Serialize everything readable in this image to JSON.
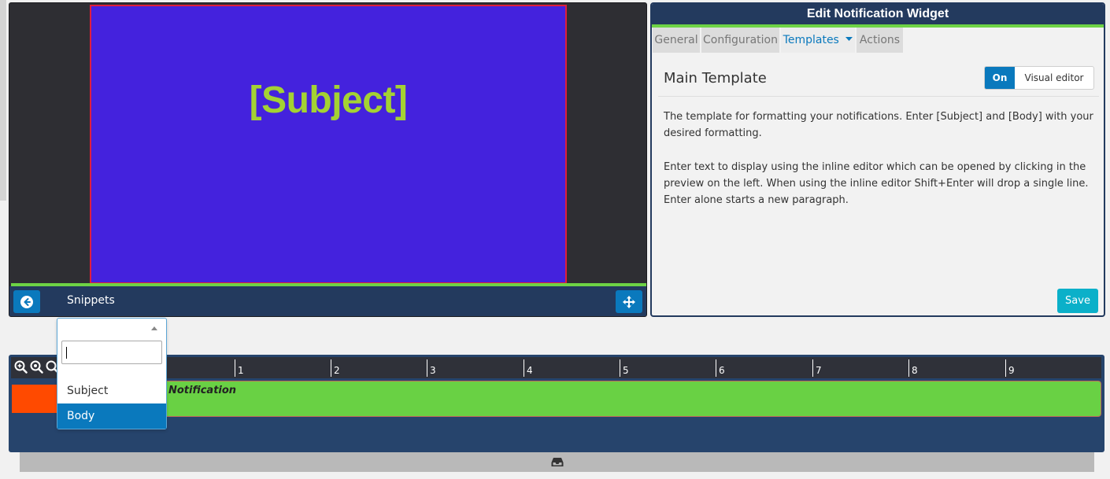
{
  "preview": {
    "canvas_text": "[Subject]",
    "snippets_label": "Snippets",
    "colors": {
      "canvas": "#4422dd",
      "canvas_border": "#e01e3c",
      "subject_text": "#a4d233"
    }
  },
  "editor": {
    "title": "Edit Notification Widget",
    "tabs": [
      {
        "label": "General"
      },
      {
        "label": "Configuration"
      },
      {
        "label": "Templates"
      },
      {
        "label": "Actions"
      }
    ],
    "active_tab": "Templates",
    "section_title": "Main Template",
    "toggle": {
      "on_label": "On",
      "visual_label": "Visual editor"
    },
    "paragraph1": "The template for formatting your notifications. Enter [Subject] and [Body] with your desired formatting.",
    "paragraph2": "Enter text to display using the inline editor which can be opened by clicking in the preview on the left. When using the inline editor Shift+Enter will drop a single line. Enter alone starts a new paragraph.",
    "save_label": "Save"
  },
  "dropdown": {
    "search_value": "",
    "options": [
      {
        "label": "Subject"
      },
      {
        "label": "Body"
      }
    ],
    "selected": "Body"
  },
  "timeline": {
    "ticks": [
      "1",
      "2",
      "3",
      "4",
      "5",
      "6",
      "7",
      "8",
      "9"
    ],
    "bar_label": "Notification",
    "colors": {
      "bar": "#69d144",
      "marker": "#ff4a00"
    }
  },
  "icons": {
    "back": "arrow-left-circle-icon",
    "move": "move-arrows-icon",
    "zoom_in": "zoom-in-icon",
    "zoom_fit": "zoom-fit-icon",
    "zoom_out": "zoom-out-icon",
    "tray": "inbox-tray-icon",
    "caret": "caret-down-icon"
  }
}
